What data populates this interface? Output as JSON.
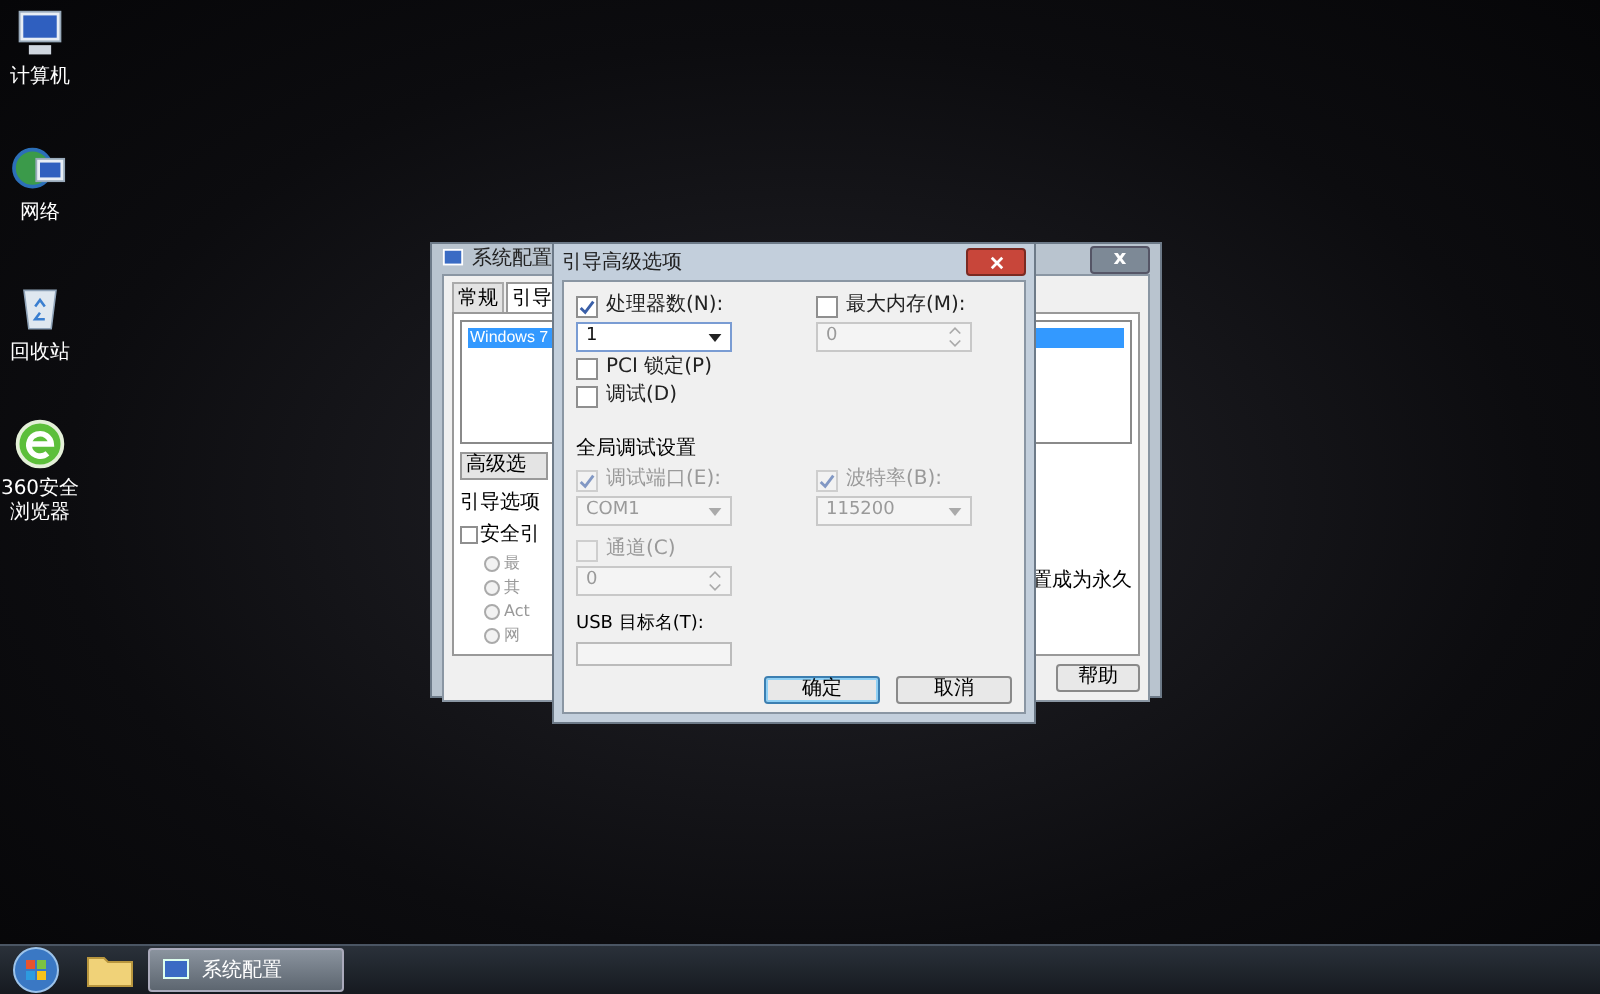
{
  "desktop_icons": [
    {
      "label": "计算机",
      "kind": "computer"
    },
    {
      "label": "网络",
      "kind": "network"
    },
    {
      "label": "回收站",
      "kind": "recycle"
    },
    {
      "label": "360安全浏览器",
      "kind": "browser"
    }
  ],
  "back_window": {
    "title": "系统配置",
    "close": "x",
    "tabs": [
      {
        "label": "常规",
        "selected": false
      },
      {
        "label": "引导",
        "selected": true
      }
    ],
    "boot_list": [
      {
        "label": "Windows 7",
        "selected": true
      }
    ],
    "advanced_button": "高级选",
    "boot_options_label": "引导选项",
    "safe_boot": {
      "label": "安全引",
      "checked": false
    },
    "radio_options": [
      {
        "label": "最",
        "selected": false
      },
      {
        "label": "其",
        "selected": false
      },
      {
        "label": "Act",
        "selected": false
      },
      {
        "label": "网",
        "selected": false
      }
    ],
    "right_text": "置成为永久",
    "help_button": "帮助"
  },
  "dialog": {
    "title": "引导高级选项",
    "processors": {
      "label": "处理器数(N):",
      "checked": true,
      "value": "1"
    },
    "max_memory": {
      "label": "最大内存(M):",
      "checked": false,
      "value": "0"
    },
    "pci_lock": {
      "label": "PCI 锁定(P)",
      "checked": false
    },
    "debug": {
      "label": "调试(D)",
      "checked": false
    },
    "global_debug_heading": "全局调试设置",
    "debug_port": {
      "label": "调试端口(E):",
      "checked": true,
      "disabled": true,
      "value": "COM1"
    },
    "baud_rate": {
      "label": "波特率(B):",
      "checked": true,
      "disabled": true,
      "value": "115200"
    },
    "channel": {
      "label": "通道(C)",
      "checked": false,
      "disabled": true,
      "value": "0"
    },
    "usb_target": {
      "label": "USB 目标名(T):"
    },
    "buttons": [
      {
        "label": "确定",
        "kind": "default"
      },
      {
        "label": "取消",
        "kind": "normal"
      }
    ]
  },
  "taskbar": {
    "tasks": [
      {
        "label": "系统配置",
        "selected": true
      }
    ]
  }
}
